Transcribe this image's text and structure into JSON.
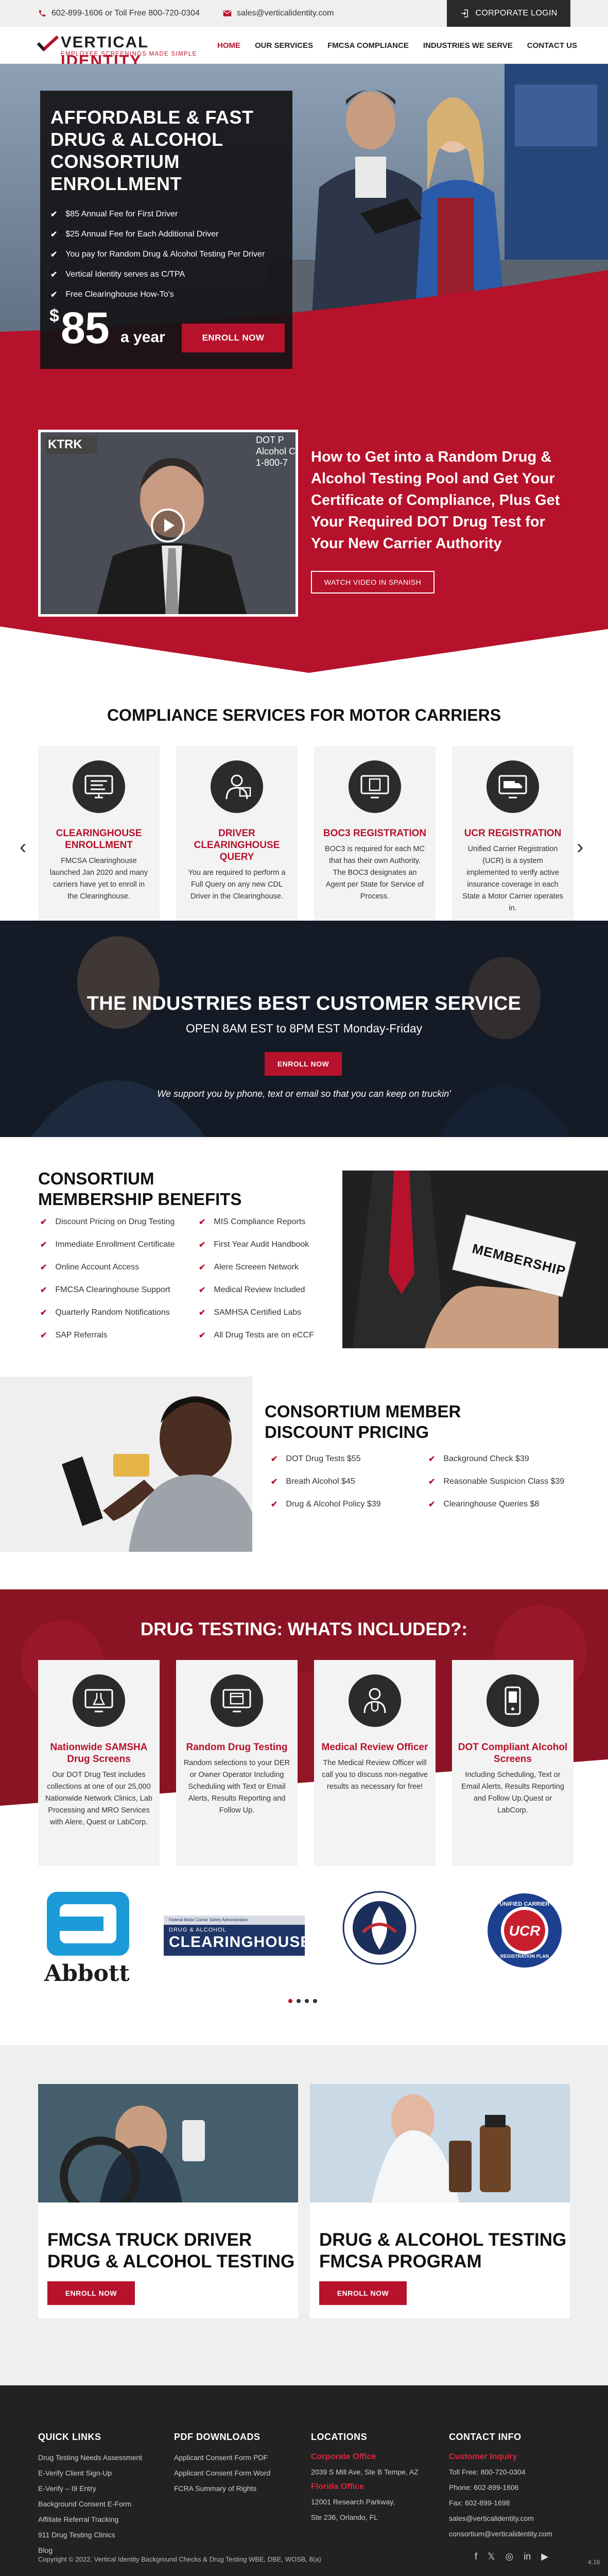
{
  "topbar": {
    "phone_text": "602-899-1606 or Toll Free 800-720-0304",
    "email_text": "sales@verticalidentity.com",
    "login_label": "CORPORATE LOGIN"
  },
  "brand": {
    "name_a": "VERTICAL ",
    "name_b": "IDENTITY",
    "tagline": "EMPLOYEE SCREENINGS MADE SIMPLE"
  },
  "nav": {
    "items": [
      "HOME",
      "OUR SERVICES",
      "FMCSA COMPLIANCE",
      "INDUSTRIES WE SERVE",
      "CONTACT US"
    ]
  },
  "hero": {
    "title": "AFFORDABLE & FAST  DRUG & ALCOHOL CONSORTIUM ENROLLMENT",
    "bullets": [
      "$85 Annual Fee for First Driver",
      "$25 Annual Fee for Each Additional Driver",
      "You pay for Random Drug & Alcohol Testing Per Driver",
      "Vertical Identity serves as C/TPA",
      "Free Clearinghouse How-To's"
    ],
    "price_symbol": "$",
    "price_amount": "85",
    "price_period": "a year",
    "enroll_label": "ENROLL NOW"
  },
  "video_section": {
    "video_brand": "KTRK",
    "video_overlay": "DOT P\nAlcohol C\n1-800-7",
    "heading": "How to Get into a Random Drug & Alcohol Testing Pool and Get Your Certificate of Compliance, Plus Get Your Required DOT Drug Test for Your New Carrier Authority",
    "spanish_label": "WATCH VIDEO IN SPANISH"
  },
  "services": {
    "title": "COMPLIANCE SERVICES FOR MOTOR CARRIERS",
    "cards": [
      {
        "title": "CLEARINGHOUSE ENROLLMENT",
        "text": "FMCSA Clearinghouse launched Jan 2020 and many carriers have yet to enroll in the Clearinghouse.",
        "icon": "monitor-icon"
      },
      {
        "title": "DRIVER CLEARINGHOUSE QUERY",
        "text": "You are required to perform a Full Query on any new CDL Driver in the Clearinghouse.",
        "icon": "driver-icon"
      },
      {
        "title": "BOC3 REGISTRATION",
        "text": "BOC3 is required for each MC that has their own Authority. The BOC3 designates an Agent per State for Service of Process.",
        "icon": "document-monitor-icon"
      },
      {
        "title": "UCR REGISTRATION",
        "text": "Unified Carrier Registration (UCR) is a system implemented to verify active insurance coverage in each State a Motor Carrier operates in.",
        "icon": "truck-monitor-icon"
      }
    ]
  },
  "customer_service": {
    "title": "THE INDUSTRIES BEST CUSTOMER SERVICE",
    "hours": "OPEN 8AM EST to 8PM EST Monday-Friday",
    "enroll_label": "ENROLL NOW",
    "subtitle": "We support you by phone, text or email so that you can keep on truckin'"
  },
  "benefits": {
    "title_line1": "CONSORTIUM",
    "title_line2": "MEMBERSHIP BENEFITS",
    "left": [
      "Discount Pricing on Drug Testing",
      "Immediate Enrollment Certificate",
      "Online Account Access",
      "FMCSA Clearinghouse Support",
      "Quarterly Random Notifications",
      "SAP Referrals"
    ],
    "right": [
      "MIS Compliance Reports",
      "First Year Audit Handbook",
      "Alere Screeen Network",
      "Medical Review Included",
      "SAMHSA Certified Labs",
      "All Drug Tests are on eCCF"
    ],
    "card_text": "MEMBERSHIP"
  },
  "discount": {
    "title_line1": "CONSORTIUM MEMBER",
    "title_line2": "DISCOUNT PRICING",
    "left": [
      "DOT Drug Tests $55",
      "Breath Alcohol $45",
      "Drug & Alcohol Policy $39"
    ],
    "right": [
      "Background Check $39",
      "Reasonable Suspicion Class $39",
      "Clearinghouse Queries $8"
    ]
  },
  "drug_testing": {
    "title": "DRUG TESTING: WHATS INCLUDED?:",
    "cards": [
      {
        "title": "Nationwide SAMSHA Drug Screens",
        "text": "Our DOT Drug Test includes collections at one of our 25,000 Nationwide Network Clinics, Lab Processing and MRO Services with Alere, Quest or LabCorp.",
        "icon": "lab-monitor-icon"
      },
      {
        "title": "Random Drug Testing",
        "text": "Random selections to your DER or Owner Operator Including Scheduling with Text or Email Alerts, Results Reporting and Follow Up.",
        "icon": "calendar-monitor-icon"
      },
      {
        "title": "Medical Review Officer",
        "text": "The Medical Review Officer will call you to discuss non-negative results as necessary for free!",
        "icon": "doctor-icon"
      },
      {
        "title": "DOT Compliant Alcohol Screens",
        "text": "Including Scheduling, Text or Email Alerts, Results Reporting and Follow Up.Quest or LabCorp.",
        "icon": "phone-device-icon"
      }
    ]
  },
  "partners": {
    "abbott": "Abbott",
    "clearinghouse_small": "Federal Motor Carrier Safety Administration",
    "clearinghouse_sub": "DRUG & ALCOHOL",
    "clearinghouse": "CLEARINGHOUSE",
    "dot": "DEPARTMENT OF TRANSPORTATION · UNITED STATES OF AMERICA",
    "ucr_top": "UNIFIED CARRIER",
    "ucr_mid": "UCR",
    "ucr_bottom": "REGISTRATION PLAN"
  },
  "lower_cards": [
    {
      "title": "FMCSA TRUCK DRIVER DRUG & ALCOHOL TESTING",
      "button": "ENROLL NOW"
    },
    {
      "title": "DRUG & ALCOHOL TESTING FMCSA PROGRAM",
      "button": "ENROLL NOW"
    }
  ],
  "footer": {
    "quick_title": "QUICK LINKS",
    "quick_links": [
      "Drug Testing Needs Assessment",
      "E-Verify Client Sign-Up",
      "E-Verify – I9 Entry",
      "Background Consent E-Form",
      "Affiliate Referral Tracking",
      "911 Drug Testing Clinics",
      "Blog"
    ],
    "pdf_title": "PDF DOWNLOADS",
    "pdf_links": [
      "Applicant Consent Form PDF",
      "Applicant Consent Form Word",
      "FCRA Summary of Rights"
    ],
    "loc_title": "LOCATIONS",
    "corp_title": "Corporate Office",
    "corp_addr": "2039 S Mill Ave, Ste B Tempe, AZ",
    "fl_title": "Florida Office",
    "fl_addr1": "12001 Research Parkway,",
    "fl_addr2": "Ste 236, Orlando, FL",
    "contact_title": "CONTACT INFO",
    "customer_title": "Customer Inquiry",
    "contact_lines": [
      "Toll Free: 800-720-0304",
      "Phone: 602-899-1606",
      "Fax: 602-899-1698",
      "sales@verticalidentity.com",
      "consortium@verticalidentity.com"
    ],
    "copyright": "Copyright © 2022. Vertical Identity Background Checks &  Drug Testing WBE, DBE, WOSB, 8(a)",
    "version": "4.16"
  },
  "colors": {
    "brand_red": "#b6122b",
    "dark": "#222222",
    "light_gray": "#f3f3f3"
  }
}
